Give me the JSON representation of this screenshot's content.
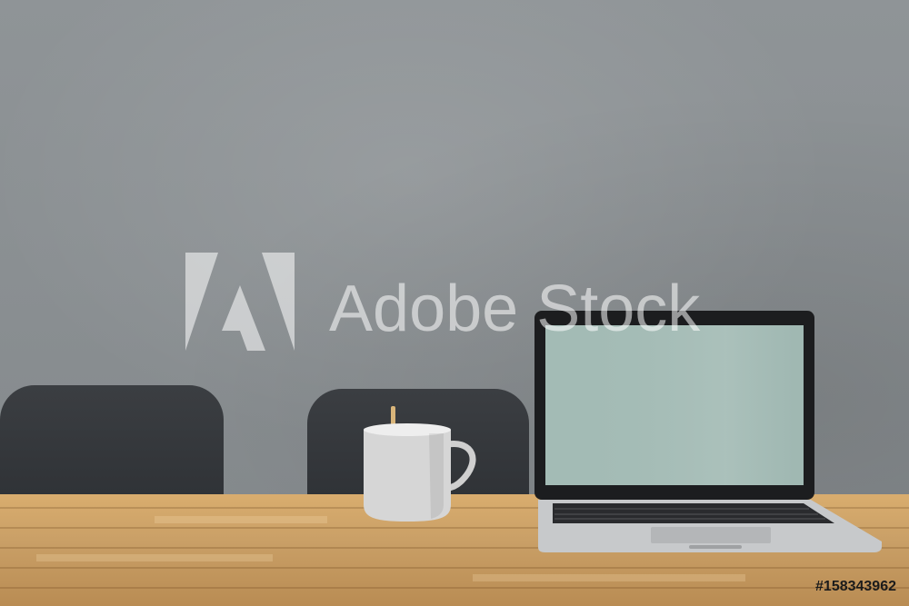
{
  "watermark": {
    "text": "Adobe Stock",
    "logo_icon": "adobe-logo-icon"
  },
  "image_id": "#158343962",
  "colors": {
    "wall": "#8c9194",
    "table": "#d0a569",
    "chair": "#33363a",
    "mug": "#d9d9d9",
    "screen": "#9fb8b2",
    "laptop_body": "#c9cbcd"
  }
}
